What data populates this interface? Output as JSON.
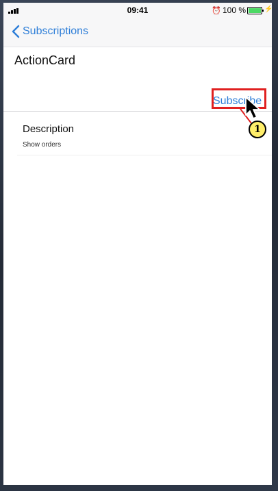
{
  "statusbar": {
    "time": "09:41",
    "alarm_icon": "⏰",
    "battery_pct": "100 %",
    "charging_icon": "⚡"
  },
  "navbar": {
    "back_label": "Subscriptions"
  },
  "card": {
    "title": "ActionCard",
    "subscribe_label": "Subscribe",
    "description_label": "Description",
    "description_value": "Show orders"
  },
  "annotation": {
    "step_number": "1",
    "highlight_color": "#e02020",
    "badge_color": "#ffee6a"
  },
  "colors": {
    "accent": "#2f7fd8",
    "battery": "#4cd964"
  }
}
